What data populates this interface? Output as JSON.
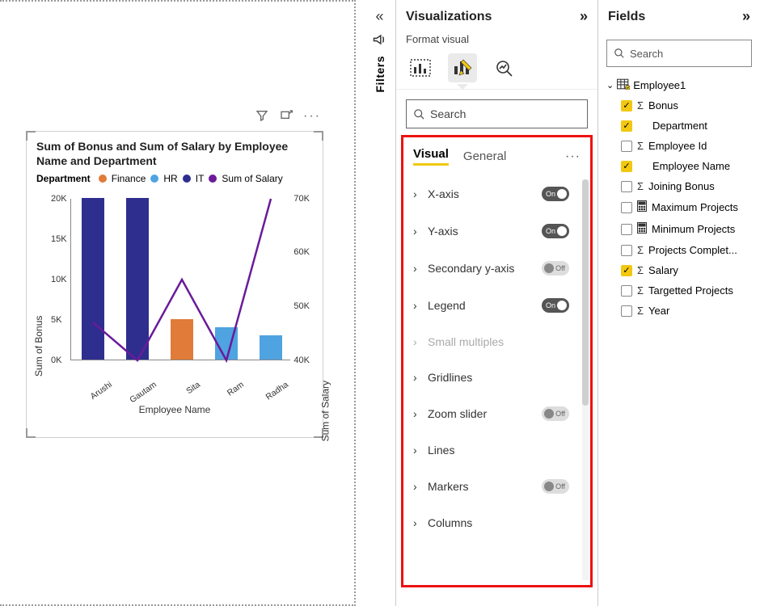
{
  "filters": {
    "label": "Filters"
  },
  "viz": {
    "title": "Visualizations",
    "subtitle": "Format visual",
    "search": "Search",
    "tabs": {
      "visual": "Visual",
      "general": "General"
    },
    "rows": {
      "xaxis": "X-axis",
      "yaxis": "Y-axis",
      "secy": "Secondary y-axis",
      "legend": "Legend",
      "small": "Small multiples",
      "grid": "Gridlines",
      "zoom": "Zoom slider",
      "lines": "Lines",
      "markers": "Markers",
      "columns": "Columns"
    },
    "toggle": {
      "on": "On",
      "off": "Off"
    }
  },
  "fields": {
    "title": "Fields",
    "search": "Search",
    "table": "Employee1",
    "items": {
      "bonus": "Bonus",
      "dept": "Department",
      "empid": "Employee Id",
      "empname": "Employee Name",
      "joinbonus": "Joining Bonus",
      "maxproj": "Maximum Projects",
      "minproj": "Minimum Projects",
      "projcomp": "Projects Complet...",
      "salary": "Salary",
      "targproj": "Targetted Projects",
      "year": "Year"
    }
  },
  "chart": {
    "title": "Sum of Bonus and Sum of Salary by Employee Name and Department",
    "legend_head": "Department",
    "legend_items": {
      "finance": "Finance",
      "hr": "HR",
      "it": "IT",
      "sos": "Sum of Salary"
    },
    "ylab_left": "Sum of Bonus",
    "ylab_right": "Sum of Salary",
    "xlab": "Employee Name",
    "yticks_l": {
      "y0": "0K",
      "y5": "5K",
      "y10": "10K",
      "y15": "15K",
      "y20": "20K"
    },
    "yticks_r": {
      "y40": "40K",
      "y50": "50K",
      "y60": "60K",
      "y70": "70K"
    },
    "xticks": {
      "a": "Arushi",
      "b": "Gautam",
      "c": "Sita",
      "d": "Ram",
      "e": "Radha"
    }
  },
  "chart_data": {
    "type": "bar",
    "title": "Sum of Bonus and Sum of Salary by Employee Name and Department",
    "xlabel": "Employee Name",
    "ylabel": "Sum of Bonus",
    "y2label": "Sum of Salary",
    "ylim": [
      0,
      20000
    ],
    "y2lim": [
      40000,
      70000
    ],
    "categories": [
      "Arushi",
      "Gautam",
      "Sita",
      "Ram",
      "Radha"
    ],
    "series": [
      {
        "name": "Finance",
        "axis": "y",
        "color": "#E07B39",
        "values": [
          null,
          null,
          5000,
          null,
          null
        ]
      },
      {
        "name": "HR",
        "axis": "y",
        "color": "#4FA3E0",
        "values": [
          null,
          null,
          null,
          4000,
          3000
        ]
      },
      {
        "name": "IT",
        "axis": "y",
        "color": "#2E2E8F",
        "values": [
          20000,
          20000,
          null,
          null,
          null
        ]
      },
      {
        "name": "Sum of Salary",
        "axis": "y2",
        "type": "line",
        "color": "#6A1B9A",
        "values": [
          47000,
          40000,
          55000,
          40000,
          70000
        ]
      }
    ],
    "legend_title": "Department"
  }
}
